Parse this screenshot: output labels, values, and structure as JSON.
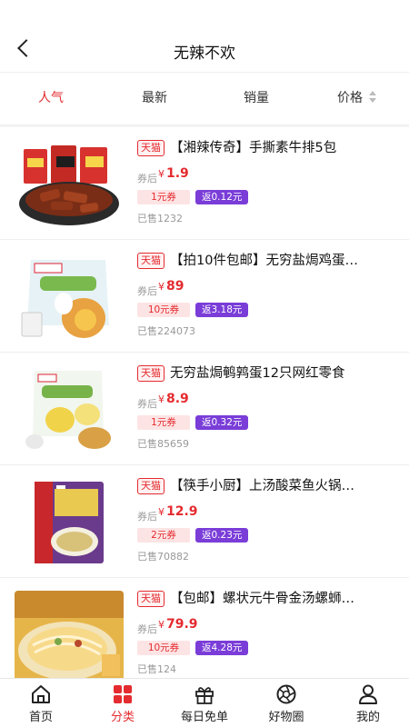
{
  "header": {
    "title": "无辣不欢"
  },
  "sort": {
    "items": [
      {
        "label": "人气",
        "active": true
      },
      {
        "label": "最新"
      },
      {
        "label": "销量"
      },
      {
        "label": "价格"
      }
    ]
  },
  "products": [
    {
      "platform": "天猫",
      "name": "【湘辣传奇】手撕素牛排5包",
      "price_prefix": "券后",
      "currency": "¥",
      "price": "1.9",
      "coupon": "1元券",
      "rebate": "返0.12元",
      "sold": "已售1232"
    },
    {
      "platform": "天猫",
      "name": "【拍10件包邮】无穷盐焗鸡蛋…",
      "price_prefix": "券后",
      "currency": "¥",
      "price": "89",
      "coupon": "10元券",
      "rebate": "返3.18元",
      "sold": "已售224073"
    },
    {
      "platform": "天猫",
      "name": "无穷盐焗鹌鹑蛋12只网红零食",
      "price_prefix": "券后",
      "currency": "¥",
      "price": "8.9",
      "coupon": "1元券",
      "rebate": "返0.32元",
      "sold": "已售85659"
    },
    {
      "platform": "天猫",
      "name": "【筷手小厨】上汤酸菜鱼火锅…",
      "price_prefix": "券后",
      "currency": "¥",
      "price": "12.9",
      "coupon": "2元券",
      "rebate": "返0.23元",
      "sold": "已售70882"
    },
    {
      "platform": "天猫",
      "name": "【包邮】螺状元牛骨金汤螺蛳…",
      "price_prefix": "券后",
      "currency": "¥",
      "price": "79.9",
      "coupon": "10元券",
      "rebate": "返4.28元",
      "sold": "已售124"
    }
  ],
  "tabbar": {
    "items": [
      {
        "label": "首页",
        "icon": "home-icon"
      },
      {
        "label": "分类",
        "icon": "category-icon",
        "active": true
      },
      {
        "label": "每日免单",
        "icon": "gift-icon"
      },
      {
        "label": "好物圈",
        "icon": "aperture-icon"
      },
      {
        "label": "我的",
        "icon": "user-icon"
      }
    ]
  },
  "colors": {
    "accent": "#e42b2f",
    "rebate": "#7a3dd8",
    "coupon_bg": "#fde4e4"
  }
}
